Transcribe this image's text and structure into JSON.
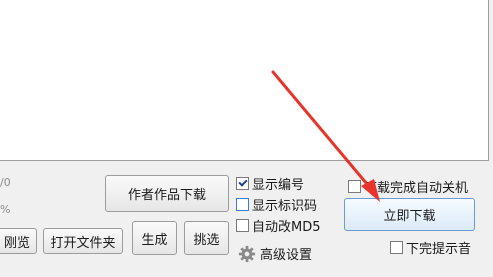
{
  "status": {
    "count_fragment": "/0",
    "percent_fragment": "%"
  },
  "buttons": {
    "preview_fragment": "刚览",
    "open_folder": "打开文件夹",
    "author_download": "作者作品下载",
    "generate": "生成",
    "pick": "挑选",
    "download_now": "立即下载"
  },
  "options": {
    "show_number": {
      "label": "显示编号",
      "checked": true
    },
    "show_id_code": {
      "label": "显示标识码",
      "checked": false
    },
    "auto_md5": {
      "label": "自动改MD5",
      "checked": false
    },
    "advanced_settings": "高级设置",
    "auto_shutdown": {
      "label": "下载完成自动关机",
      "checked": false
    },
    "finish_sound": {
      "label": "下完提示音",
      "checked": false
    }
  },
  "annotation": {
    "color": "#e8352b"
  }
}
